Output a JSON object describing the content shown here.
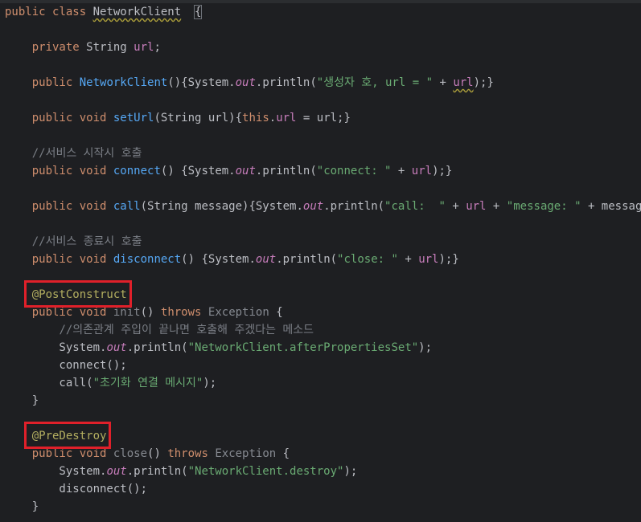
{
  "editor": {
    "lines": [
      {
        "tokens": [
          [
            "kw",
            "public "
          ],
          [
            "kw",
            "class "
          ],
          [
            "cls warn",
            "NetworkClient"
          ],
          [
            "cls",
            "  "
          ],
          [
            "cls caret-brace",
            "{"
          ]
        ]
      },
      {
        "tokens": []
      },
      {
        "tokens": [
          [
            "cls",
            "    "
          ],
          [
            "kw",
            "private "
          ],
          [
            "cls",
            "String "
          ],
          [
            "fld",
            "url"
          ],
          [
            "cls",
            ";"
          ]
        ]
      },
      {
        "tokens": []
      },
      {
        "tokens": [
          [
            "cls",
            "    "
          ],
          [
            "kw",
            "public "
          ],
          [
            "fn",
            "NetworkClient"
          ],
          [
            "cls",
            "(){System."
          ],
          [
            "ital",
            "out"
          ],
          [
            "cls",
            ".println("
          ],
          [
            "str",
            "\"생성자 호, url = \""
          ],
          [
            "cls",
            " + "
          ],
          [
            "fld warn",
            "url"
          ],
          [
            "cls",
            ");}"
          ]
        ]
      },
      {
        "tokens": []
      },
      {
        "tokens": [
          [
            "cls",
            "    "
          ],
          [
            "kw",
            "public void "
          ],
          [
            "fn",
            "setUrl"
          ],
          [
            "cls",
            "(String url){"
          ],
          [
            "kw",
            "this"
          ],
          [
            "cls",
            "."
          ],
          [
            "fld",
            "url"
          ],
          [
            "cls",
            " = url;}"
          ]
        ]
      },
      {
        "tokens": []
      },
      {
        "tokens": [
          [
            "cls",
            "    "
          ],
          [
            "cmt",
            "//서비스 시작시 호출"
          ]
        ]
      },
      {
        "tokens": [
          [
            "cls",
            "    "
          ],
          [
            "kw",
            "public void "
          ],
          [
            "fn",
            "connect"
          ],
          [
            "cls",
            "() {System."
          ],
          [
            "ital",
            "out"
          ],
          [
            "cls",
            ".println("
          ],
          [
            "str",
            "\"connect: \""
          ],
          [
            "cls",
            " + "
          ],
          [
            "fld",
            "url"
          ],
          [
            "cls",
            ");}"
          ]
        ]
      },
      {
        "tokens": []
      },
      {
        "tokens": [
          [
            "cls",
            "    "
          ],
          [
            "kw",
            "public void "
          ],
          [
            "fn",
            "call"
          ],
          [
            "cls",
            "(String message){System."
          ],
          [
            "ital",
            "out"
          ],
          [
            "cls",
            ".println("
          ],
          [
            "str",
            "\"call:  \""
          ],
          [
            "cls",
            " + "
          ],
          [
            "fld",
            "url"
          ],
          [
            "cls",
            " + "
          ],
          [
            "str",
            "\"message: \""
          ],
          [
            "cls",
            " + message);}"
          ]
        ]
      },
      {
        "tokens": []
      },
      {
        "tokens": [
          [
            "cls",
            "    "
          ],
          [
            "cmt",
            "//서비스 종료시 호출"
          ]
        ]
      },
      {
        "tokens": [
          [
            "cls",
            "    "
          ],
          [
            "kw",
            "public void "
          ],
          [
            "fn",
            "disconnect"
          ],
          [
            "cls",
            "() {System."
          ],
          [
            "ital",
            "out"
          ],
          [
            "cls",
            ".println("
          ],
          [
            "str",
            "\"close: \""
          ],
          [
            "cls",
            " + "
          ],
          [
            "fld",
            "url"
          ],
          [
            "cls",
            ");}"
          ]
        ]
      },
      {
        "tokens": []
      },
      {
        "tokens": [
          [
            "cls",
            "    "
          ],
          [
            "ann",
            "@PostConstruct"
          ]
        ]
      },
      {
        "tokens": [
          [
            "cls",
            "    "
          ],
          [
            "kw",
            "public void "
          ],
          [
            "unused",
            "init"
          ],
          [
            "cls",
            "() "
          ],
          [
            "kw",
            "throws "
          ],
          [
            "unused",
            "Exception"
          ],
          [
            "cls",
            " {"
          ]
        ]
      },
      {
        "tokens": [
          [
            "cls",
            "        "
          ],
          [
            "cmt",
            "//의존관계 주입이 끝나면 호출해 주겠다는 메소드"
          ]
        ]
      },
      {
        "tokens": [
          [
            "cls",
            "        System."
          ],
          [
            "ital",
            "out"
          ],
          [
            "cls",
            ".println("
          ],
          [
            "str",
            "\"NetworkClient.afterPropertiesSet\""
          ],
          [
            "cls",
            ");"
          ]
        ]
      },
      {
        "tokens": [
          [
            "cls",
            "        connect();"
          ]
        ]
      },
      {
        "tokens": [
          [
            "cls",
            "        call("
          ],
          [
            "str",
            "\"초기화 연결 메시지\""
          ],
          [
            "cls",
            ");"
          ]
        ]
      },
      {
        "tokens": [
          [
            "cls",
            "    }"
          ]
        ]
      },
      {
        "tokens": []
      },
      {
        "tokens": [
          [
            "cls",
            "    "
          ],
          [
            "ann",
            "@PreDestroy"
          ]
        ]
      },
      {
        "tokens": [
          [
            "cls",
            "    "
          ],
          [
            "kw",
            "public void "
          ],
          [
            "unused",
            "close"
          ],
          [
            "cls",
            "() "
          ],
          [
            "kw",
            "throws "
          ],
          [
            "unused",
            "Exception"
          ],
          [
            "cls",
            " {"
          ]
        ]
      },
      {
        "tokens": [
          [
            "cls",
            "        System."
          ],
          [
            "ital",
            "out"
          ],
          [
            "cls",
            ".println("
          ],
          [
            "str",
            "\"NetworkClient.destroy\""
          ],
          [
            "cls",
            ");"
          ]
        ]
      },
      {
        "tokens": [
          [
            "cls",
            "        disconnect();"
          ]
        ]
      },
      {
        "tokens": [
          [
            "cls",
            "    }"
          ]
        ]
      }
    ]
  },
  "highlights": [
    {
      "label": "PostConstruct annotation highlight"
    },
    {
      "label": "PreDestroy annotation highlight"
    }
  ]
}
